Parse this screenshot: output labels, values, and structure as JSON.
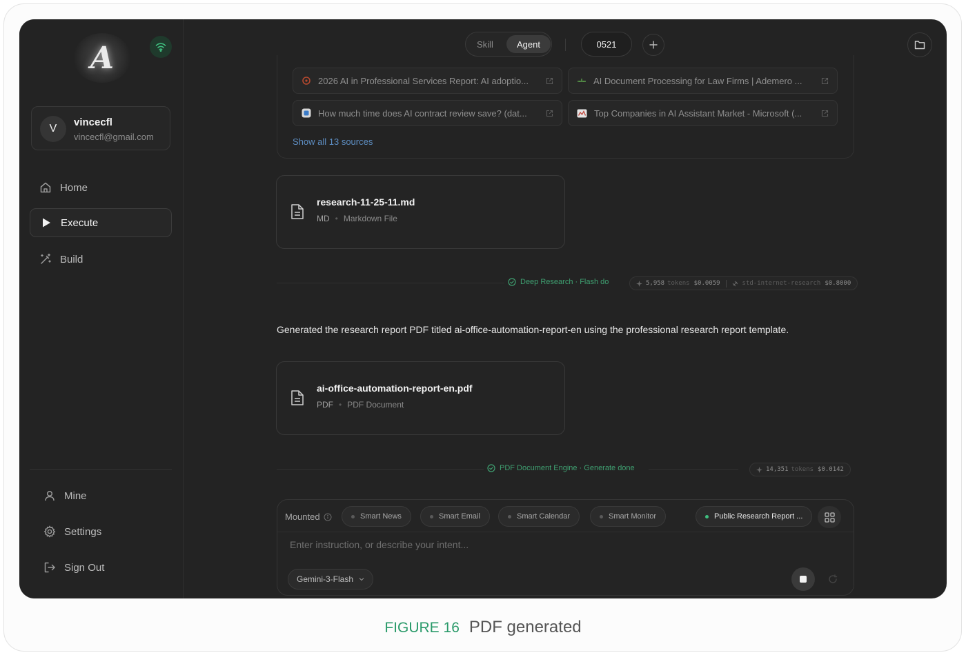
{
  "sidebar": {
    "logo_letter": "A",
    "user": {
      "initial": "V",
      "name": "vincecfl",
      "email": "vincecfl@gmail.com"
    },
    "nav": {
      "home": "Home",
      "execute": "Execute",
      "build": "Build"
    },
    "bottom_nav": {
      "mine": "Mine",
      "settings": "Settings",
      "sign_out": "Sign Out"
    }
  },
  "topbar": {
    "mode_skill": "Skill",
    "mode_agent": "Agent",
    "session_id": "0521"
  },
  "sources": {
    "items": [
      {
        "title": "2026 AI in Professional Services Report: AI adoptio..."
      },
      {
        "title": "AI Document Processing for Law Firms | Ademero ..."
      },
      {
        "title": "How much time does AI contract review save? (dat..."
      },
      {
        "title": "Top Companies in AI Assistant Market - Microsoft (..."
      }
    ],
    "show_all": "Show all 13 sources"
  },
  "files": [
    {
      "name": "research-11-25-11.md",
      "ext": "MD",
      "type": "Markdown File"
    },
    {
      "name": "ai-office-automation-report-en.pdf",
      "ext": "PDF",
      "type": "PDF Document"
    }
  ],
  "status": [
    {
      "text": "Deep Research · Flash do",
      "tokens": "5,958",
      "tokens_unit": "tokens",
      "cost": "$0.0059",
      "tool": "std-internet-research",
      "tool_cost": "$0.8000"
    },
    {
      "text": "PDF Document Engine · Generate done",
      "tokens": "14,351",
      "tokens_unit": "tokens",
      "cost": "$0.0142"
    }
  ],
  "message": "Generated the research report PDF titled ai-office-automation-report-en using the professional research report template.",
  "input": {
    "mounted_label": "Mounted",
    "skills": [
      "Smart News",
      "Smart Email",
      "Smart Calendar",
      "Smart Monitor",
      "Public Research Report ..."
    ],
    "active_skill_index": 4,
    "placeholder": "Enter instruction, or describe your intent...",
    "model": "Gemini-3-Flash"
  },
  "caption": {
    "figure": "FIGURE 16",
    "title": "PDF generated"
  },
  "colors": {
    "accent_green": "#3fa071",
    "link_blue": "#5e8fc4",
    "background": "#232323"
  },
  "icons": {
    "wifi": "wifi-icon",
    "home": "home-icon",
    "execute": "play-icon",
    "build": "magic-wand-icon",
    "mine": "user-icon",
    "settings": "gear-icon",
    "sign_out": "logout-icon",
    "folder": "folder-icon",
    "add": "plus-icon",
    "file": "document-icon",
    "external": "external-link-icon",
    "grid": "grid-icon",
    "stop": "stop-icon",
    "refresh": "refresh-icon"
  }
}
